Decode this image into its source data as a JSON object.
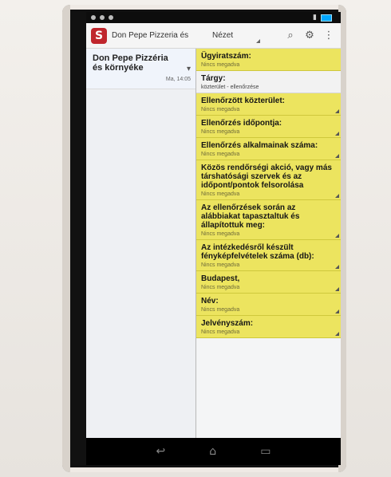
{
  "statusbar": {
    "time": "",
    "left_icons": [
      "notification-dot",
      "notification-dot",
      "notification-dot"
    ],
    "right_icons": [
      "signal-icon",
      "battery-icon"
    ]
  },
  "actionbar": {
    "logo_letter": "S",
    "app_title": "Don Pepe Pizzeria és",
    "spinner_value": "Nézet",
    "icons": [
      "search-icon",
      "settings-icon",
      "overflow-menu-icon"
    ]
  },
  "list": {
    "items": [
      {
        "title": "Don Pepe Pizzéria és környéke",
        "time": "Ma, 14:05"
      }
    ]
  },
  "fields": [
    {
      "label": "Ügyiratszám:",
      "value": "Nincs megadva",
      "style": "yellow"
    },
    {
      "label": "Tárgy:",
      "value": "közterület - ellenőrzése",
      "style": "white"
    },
    {
      "label": "Ellenőrzött közterület:",
      "value": "Nincs megadva",
      "style": "yellow"
    },
    {
      "label": "Ellenőrzés időpontja:",
      "value": "Nincs megadva",
      "style": "yellow"
    },
    {
      "label": "Ellenőrzés alkalmainak száma:",
      "value": "Nincs megadva",
      "style": "yellow"
    },
    {
      "label": "Közös rendőrségi akció, vagy más társhatósági szervek és az időpont/pontok felsorolása",
      "value": "Nincs megadva",
      "style": "yellow"
    },
    {
      "label": "Az ellenőrzések során az alábbiakat tapasztaltuk és állapítottuk meg:",
      "value": "Nincs megadva",
      "style": "yellow"
    },
    {
      "label": "Az intézkedésről készült fényképfelvételek száma (db):",
      "value": "Nincs megadva",
      "style": "yellow"
    },
    {
      "label": "Budapest,",
      "value": "Nincs megadva",
      "style": "yellow"
    },
    {
      "label": "Név:",
      "value": "Nincs megadva",
      "style": "yellow"
    },
    {
      "label": "Jelvényszám:",
      "value": "Nincs megadva",
      "style": "yellow"
    }
  ],
  "navbar": {
    "icons": [
      "back-icon",
      "home-icon",
      "recent-apps-icon"
    ]
  },
  "colors": {
    "field_yellow": "#ece45f",
    "logo_red": "#c0262d"
  }
}
